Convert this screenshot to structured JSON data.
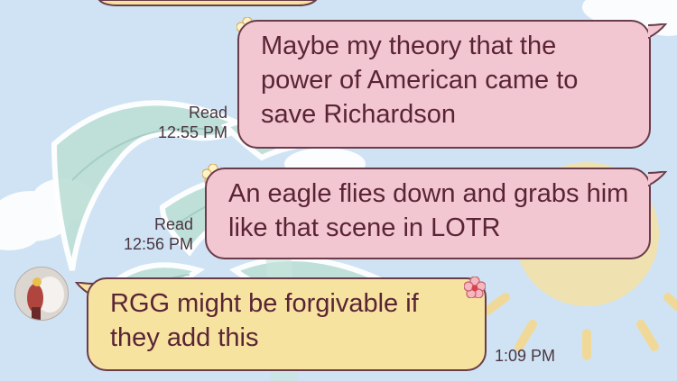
{
  "messages": [
    {
      "id": "m0",
      "side": "right",
      "text": "Maybe my theory that the power of American came to save Richardson",
      "read": "Read",
      "time": "12:55 PM"
    },
    {
      "id": "m1",
      "side": "right",
      "text": "An eagle flies down and grabs him like that scene in LOTR",
      "read": "Read",
      "time": "12:56 PM"
    },
    {
      "id": "m2",
      "side": "left",
      "text": "RGG might be forgivable if they add this",
      "time": "1:09 PM"
    }
  ],
  "colors": {
    "outgoing_bubble": "#f2c7d2",
    "incoming_bubble": "#f7e3a0",
    "bubble_border": "#6a3c4a",
    "text": "#5a2436",
    "background": "#cfe3f4"
  },
  "icons": [
    "flower-decoration-icon",
    "avatar"
  ]
}
